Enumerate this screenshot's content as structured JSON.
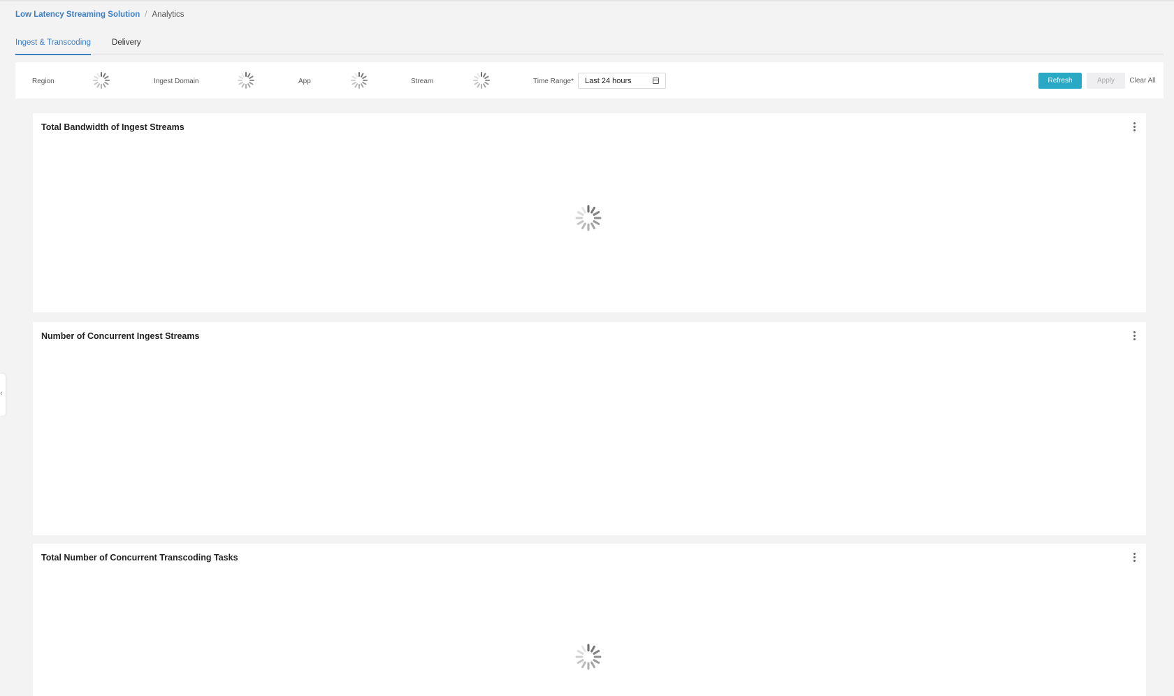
{
  "breadcrumb": {
    "root": "Low Latency Streaming Solution",
    "separator": "/",
    "current": "Analytics"
  },
  "tabs": [
    {
      "label": "Ingest & Transcoding",
      "active": true
    },
    {
      "label": "Delivery",
      "active": false
    }
  ],
  "filters": {
    "region_label": "Region",
    "ingest_domain_label": "Ingest Domain",
    "app_label": "App",
    "stream_label": "Stream",
    "time_range_label": "Time Range",
    "time_range_required_mark": "*",
    "time_range_value": "Last 24 hours",
    "refresh_label": "Refresh",
    "apply_label": "Apply",
    "clear_all_label": "Clear All"
  },
  "panels": [
    {
      "title": "Total Bandwidth of Ingest Streams",
      "loading": true
    },
    {
      "title": "Number of Concurrent Ingest Streams",
      "loading": false
    },
    {
      "title": "Total Number of Concurrent Transcoding Tasks",
      "loading": true
    }
  ],
  "colors": {
    "accent": "#3e7fc1",
    "refresh_button": "#2aa9c4",
    "background": "#f3f3f4"
  },
  "icons": {
    "filter_loading": "spinner-icon",
    "panel_menu": "kebab-menu-icon",
    "time_range": "calendar-icon",
    "side_toggle": "chevron-left-icon"
  }
}
